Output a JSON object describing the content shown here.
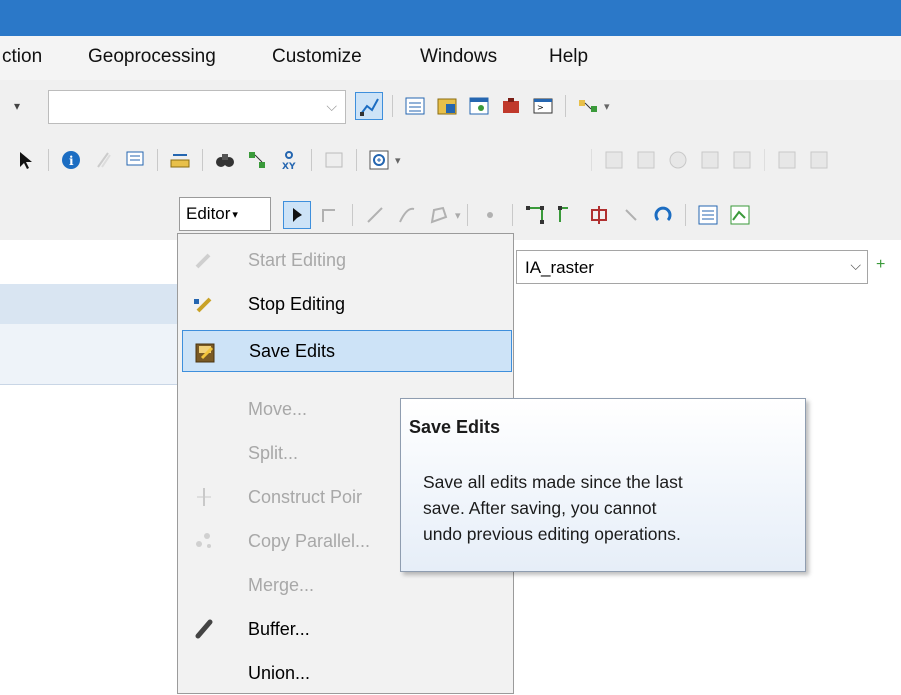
{
  "menu": {
    "items": [
      "ction",
      "Geoprocessing",
      "Customize",
      "Windows",
      "Help"
    ]
  },
  "editor_toolbar": {
    "editor_label": "Editor",
    "target_layer": "IA_raster"
  },
  "editor_menu": {
    "items": [
      {
        "label": "Start Editing",
        "enabled": false,
        "icon": "pencil-icon"
      },
      {
        "label": "Stop Editing",
        "enabled": true,
        "icon": "stop-pencil-icon"
      },
      {
        "label": "Save Edits",
        "enabled": true,
        "highlighted": true,
        "icon": "save-edits-icon"
      },
      {
        "label": "Move...",
        "enabled": false,
        "icon": ""
      },
      {
        "label": "Split...",
        "enabled": false,
        "icon": ""
      },
      {
        "label": "Construct Poir",
        "enabled": false,
        "icon": "construct-points-icon"
      },
      {
        "label": "Copy Parallel...",
        "enabled": false,
        "icon": "copy-parallel-icon"
      },
      {
        "label": "Merge...",
        "enabled": false,
        "icon": ""
      },
      {
        "label": "Buffer...",
        "enabled": true,
        "icon": "buffer-icon"
      },
      {
        "label": "Union...",
        "enabled": true,
        "icon": ""
      }
    ]
  },
  "tooltip": {
    "title": "Save Edits",
    "body_lines": [
      "Save all edits made since the last",
      "save. After saving, you cannot",
      "undo previous editing operations."
    ]
  },
  "colors": {
    "titlebar": "#2b78c8",
    "highlight": "#cde3f7",
    "highlight_border": "#3e8fdc"
  }
}
